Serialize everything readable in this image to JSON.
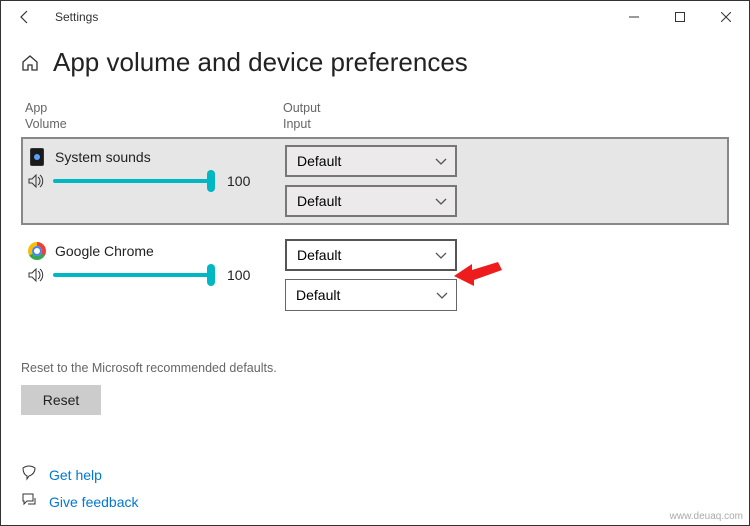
{
  "window": {
    "title": "Settings"
  },
  "page": {
    "title": "App volume and device preferences"
  },
  "columns": {
    "left_line1": "App",
    "left_line2": "Volume",
    "right_line1": "Output",
    "right_line2": "Input"
  },
  "apps": [
    {
      "name": "System sounds",
      "volume": 100,
      "output": "Default",
      "input": "Default"
    },
    {
      "name": "Google Chrome",
      "volume": 100,
      "output": "Default",
      "input": "Default"
    }
  ],
  "reset": {
    "hint": "Reset to the Microsoft recommended defaults.",
    "button": "Reset"
  },
  "footer": {
    "help": "Get help",
    "feedback": "Give feedback"
  },
  "watermark": "www.deuaq.com"
}
